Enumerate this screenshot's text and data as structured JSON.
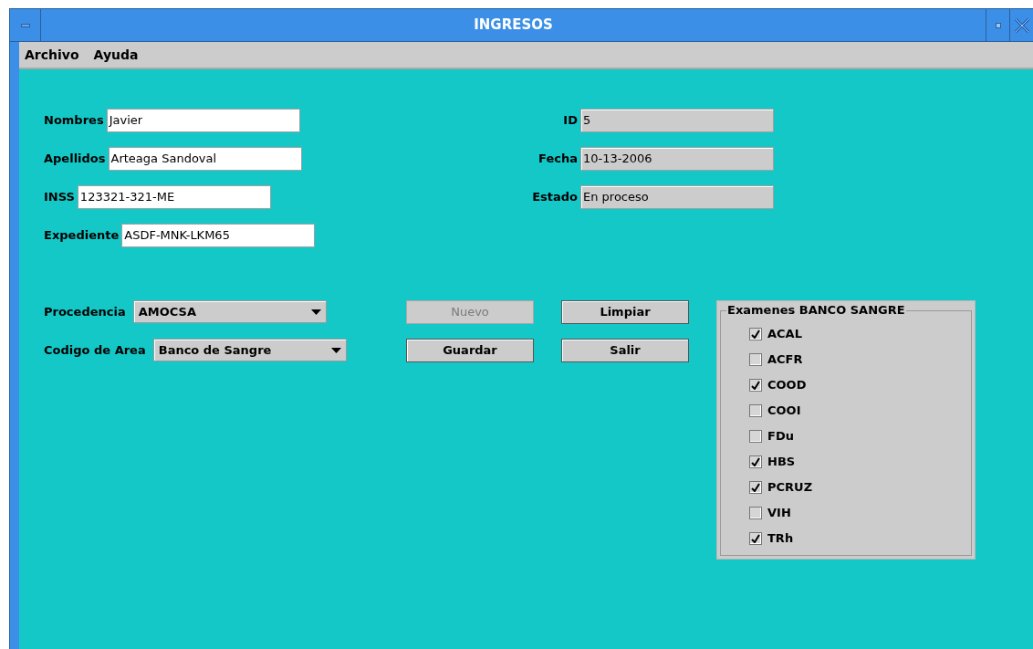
{
  "window": {
    "title": "INGRESOS"
  },
  "menu": [
    "Archivo",
    "Ayuda"
  ],
  "patient_fields": [
    {
      "label": "Nombres",
      "value": "Javier",
      "disabled": false
    },
    {
      "label": "Apellidos",
      "value": "Arteaga Sandoval",
      "disabled": false
    },
    {
      "label": "INSS",
      "value": "123321-321-ME",
      "disabled": false
    },
    {
      "label": "Expediente",
      "value": "ASDF-MNK-LKM65",
      "disabled": false
    }
  ],
  "record_fields": [
    {
      "label": "ID",
      "value": "5",
      "disabled": true
    },
    {
      "label": "Fecha",
      "value": "10-13-2006",
      "disabled": true
    },
    {
      "label": "Estado",
      "value": "En proceso",
      "disabled": true
    }
  ],
  "dropdowns": [
    {
      "label": "Procedencia",
      "value": "AMOCSA"
    },
    {
      "label": "Codigo de Area",
      "value": "Banco de Sangre"
    }
  ],
  "buttons": [
    {
      "label": "Nuevo",
      "disabled": true
    },
    {
      "label": "Limpiar",
      "disabled": false
    },
    {
      "label": "Guardar",
      "disabled": false
    },
    {
      "label": "Salir",
      "disabled": false
    }
  ],
  "exams": {
    "title": "Examenes BANCO SANGRE",
    "items": [
      {
        "label": "ACAL",
        "checked": true
      },
      {
        "label": "ACFR",
        "checked": false
      },
      {
        "label": "COOD",
        "checked": true
      },
      {
        "label": "COOI",
        "checked": false
      },
      {
        "label": "FDu",
        "checked": false
      },
      {
        "label": "HBS",
        "checked": true
      },
      {
        "label": "PCRUZ",
        "checked": true
      },
      {
        "label": "VIH",
        "checked": false
      },
      {
        "label": "TRh",
        "checked": true
      }
    ]
  }
}
